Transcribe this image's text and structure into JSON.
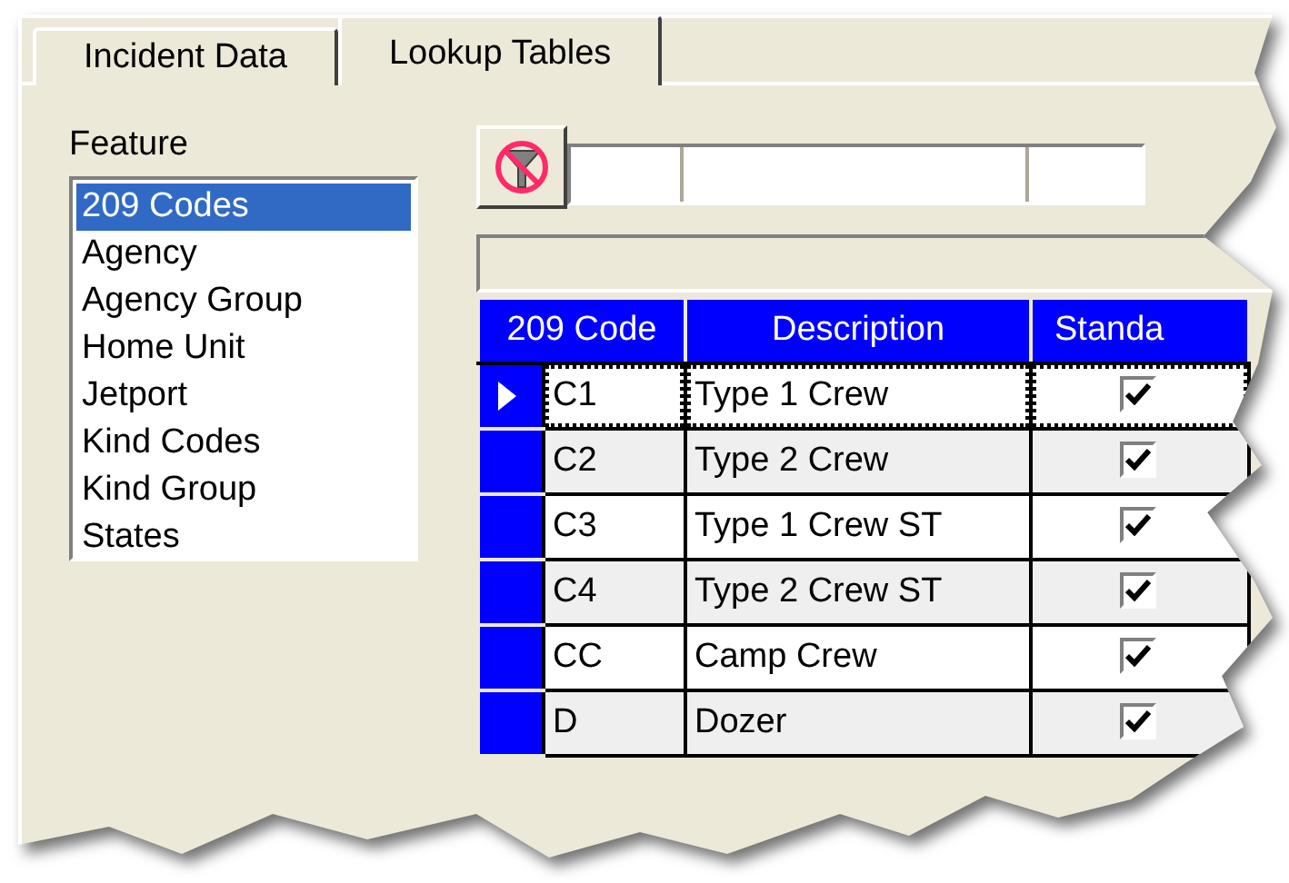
{
  "tabs": [
    {
      "label": "Incident Data",
      "selected": false
    },
    {
      "label": "Lookup Tables",
      "selected": true
    }
  ],
  "feature": {
    "label": "Feature",
    "items": [
      {
        "label": "209 Codes",
        "selected": true
      },
      {
        "label": "Agency",
        "selected": false
      },
      {
        "label": "Agency Group",
        "selected": false
      },
      {
        "label": "Home Unit",
        "selected": false
      },
      {
        "label": "Jetport",
        "selected": false
      },
      {
        "label": "Kind Codes",
        "selected": false
      },
      {
        "label": "Kind Group",
        "selected": false
      },
      {
        "label": "States",
        "selected": false
      }
    ]
  },
  "grid": {
    "columns": [
      "209 Code",
      "Description",
      "Standa"
    ],
    "rows": [
      {
        "code": "C1",
        "description": "Type 1 Crew",
        "standard": true,
        "current": true
      },
      {
        "code": "C2",
        "description": "Type 2 Crew",
        "standard": true,
        "current": false
      },
      {
        "code": "C3",
        "description": "Type 1 Crew ST",
        "standard": true,
        "current": false
      },
      {
        "code": "C4",
        "description": "Type 2 Crew ST",
        "standard": true,
        "current": false
      },
      {
        "code": "CC",
        "description": "Camp Crew",
        "standard": true,
        "current": false
      },
      {
        "code": "D",
        "description": "Dozer",
        "standard": true,
        "current": false
      }
    ]
  }
}
